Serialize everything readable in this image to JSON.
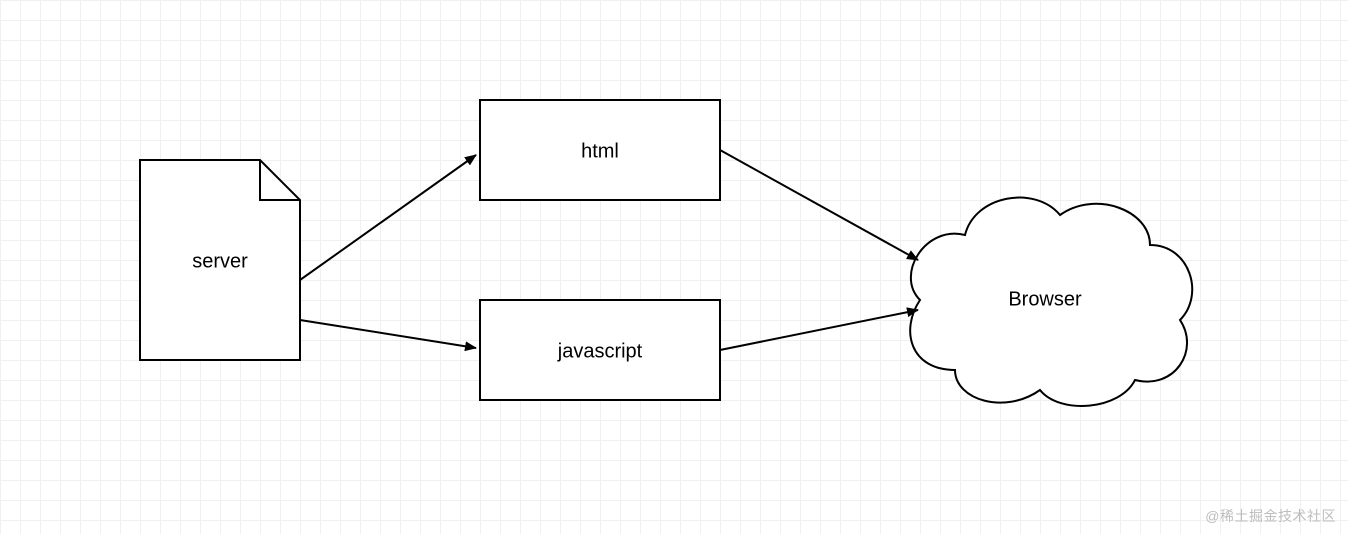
{
  "diagram": {
    "nodes": {
      "server": {
        "label": "server"
      },
      "html": {
        "label": "html"
      },
      "javascript": {
        "label": "javascript"
      },
      "browser": {
        "label": "Browser"
      }
    },
    "edges": [
      {
        "from": "server",
        "to": "html"
      },
      {
        "from": "server",
        "to": "javascript"
      },
      {
        "from": "html",
        "to": "browser"
      },
      {
        "from": "javascript",
        "to": "browser"
      }
    ]
  },
  "watermark": "@稀土掘金技术社区"
}
